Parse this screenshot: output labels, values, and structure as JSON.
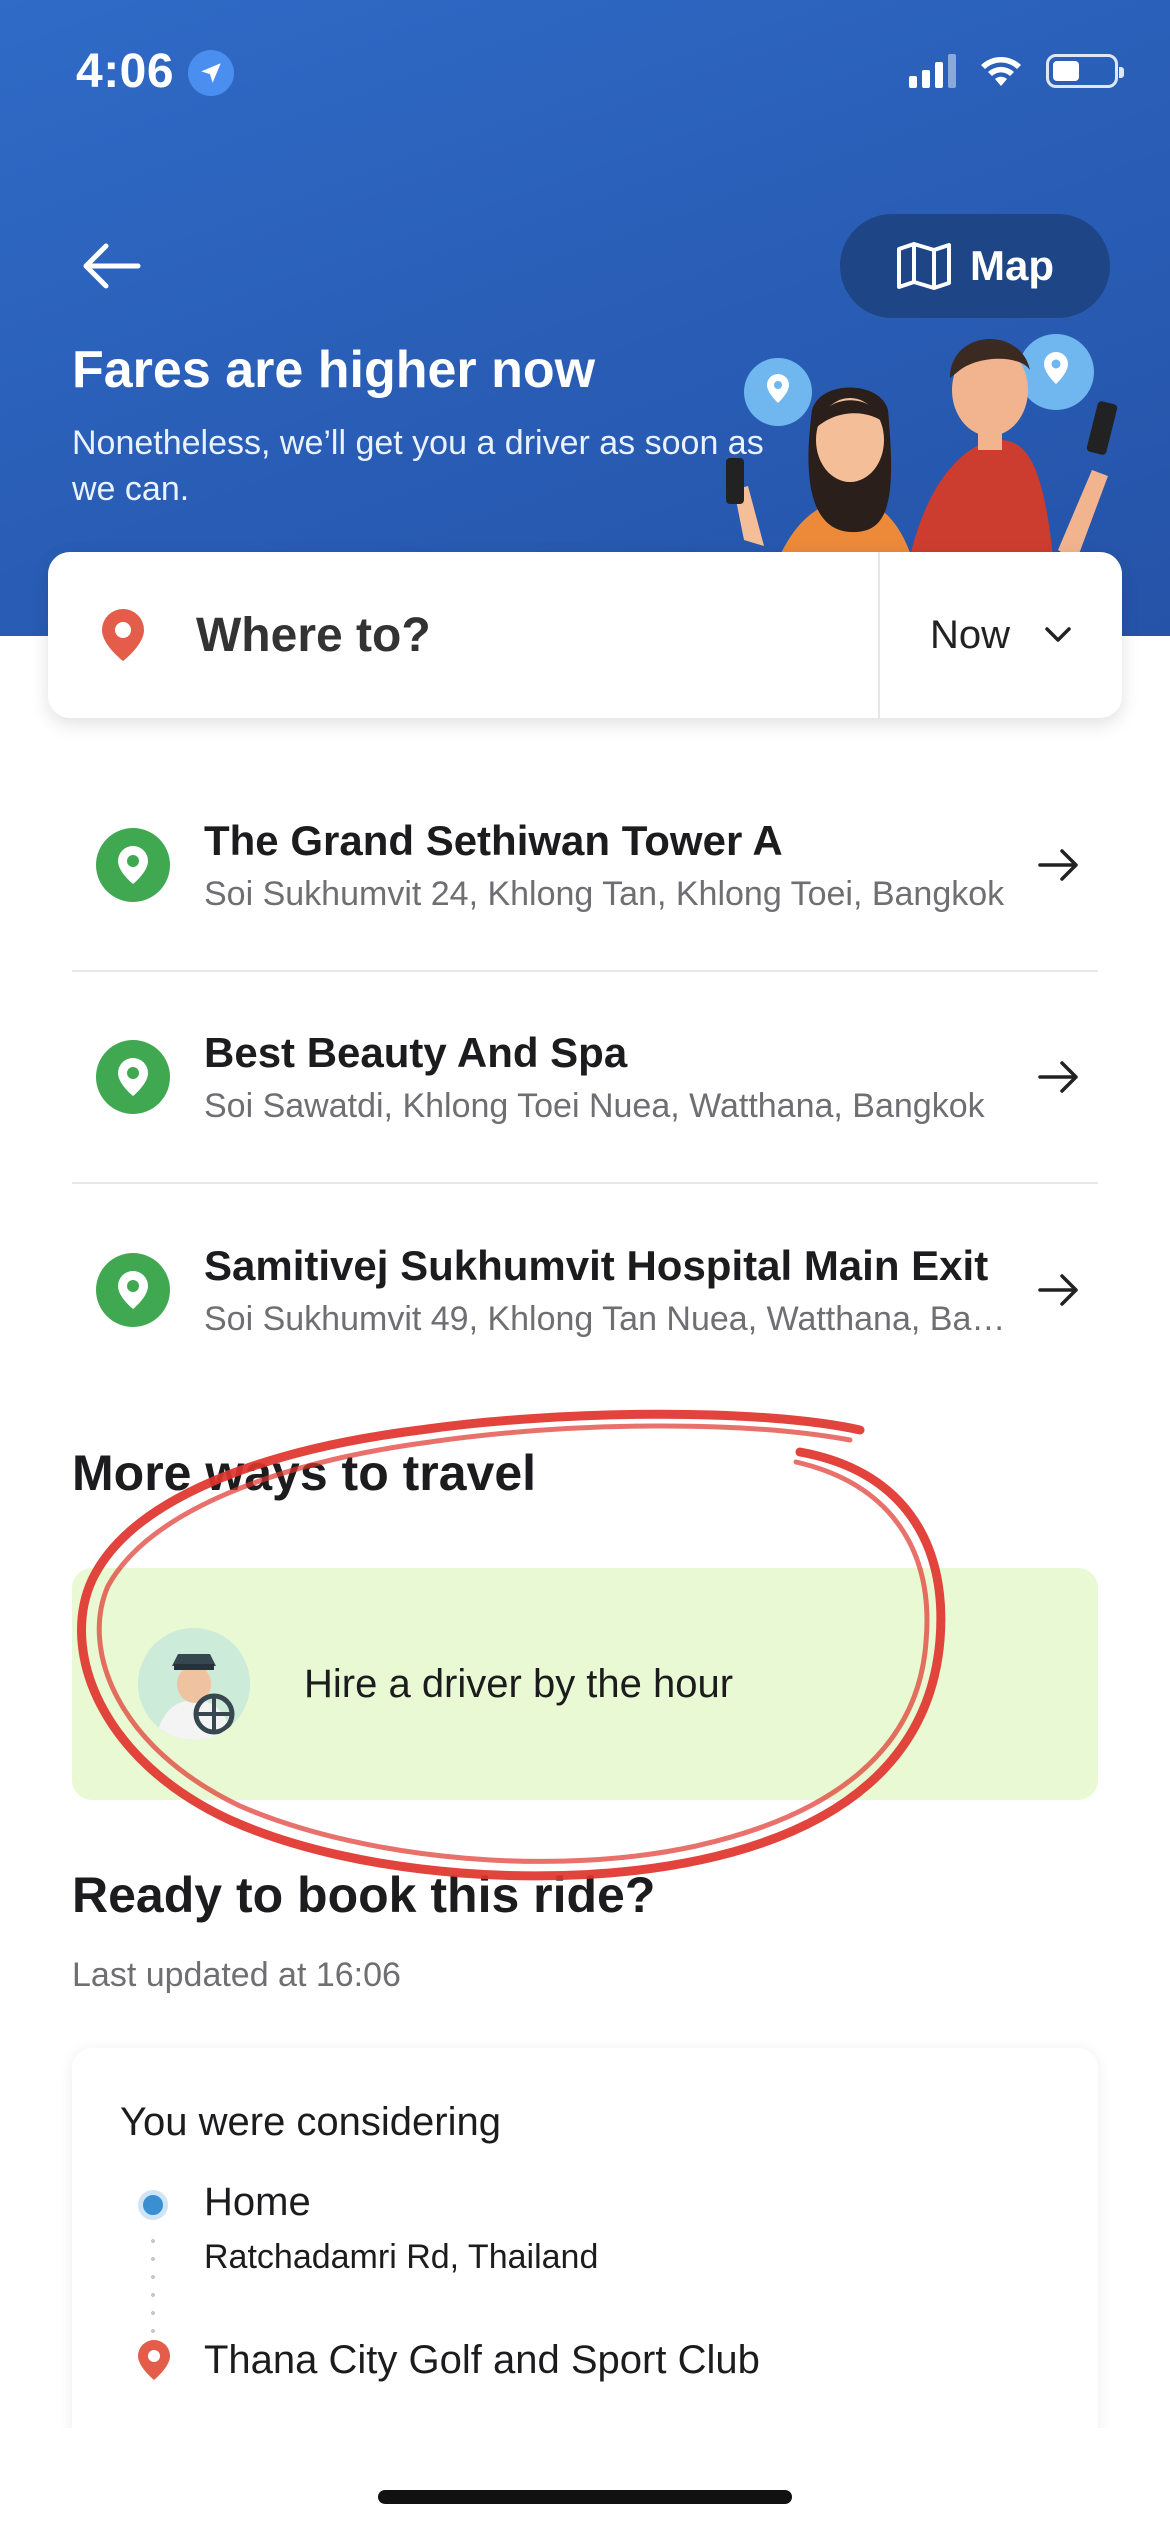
{
  "status_bar": {
    "time": "4:06"
  },
  "header": {
    "map_label": "Map",
    "title": "Fares are higher now",
    "subtitle": "Nonetheless, we’ll get you a driver as soon as we can."
  },
  "search": {
    "placeholder": "Where to?",
    "time_option": "Now"
  },
  "recent": [
    {
      "title": "The Grand Sethiwan Tower A",
      "address": "Soi Sukhumvit 24, Khlong Tan, Khlong Toei, Bangkok"
    },
    {
      "title": "Best Beauty And Spa",
      "address": "Soi Sawatdi, Khlong Toei Nuea, Watthana, Bangkok"
    },
    {
      "title": "Samitivej Sukhumvit Hospital Main Exit",
      "address": "Soi Sukhumvit 49, Khlong Tan Nuea, Watthana, Bangkok"
    }
  ],
  "more_ways": {
    "title": "More ways to travel",
    "hire_label": "Hire a driver by the hour"
  },
  "ready": {
    "title": "Ready to book this ride?",
    "updated": "Last updated at 16:06",
    "considering_label": "You were considering",
    "pickup_name": "Home",
    "pickup_address": "Ratchadamri Rd, Thailand",
    "destination_name": "Thana City Golf and Sport Club"
  },
  "colors": {
    "header_blue": "#2a5fb8",
    "map_button": "#1e4687",
    "pin_green": "#3fa851",
    "hire_bg": "#e8f9d3",
    "annotation_red": "#e0342c"
  }
}
